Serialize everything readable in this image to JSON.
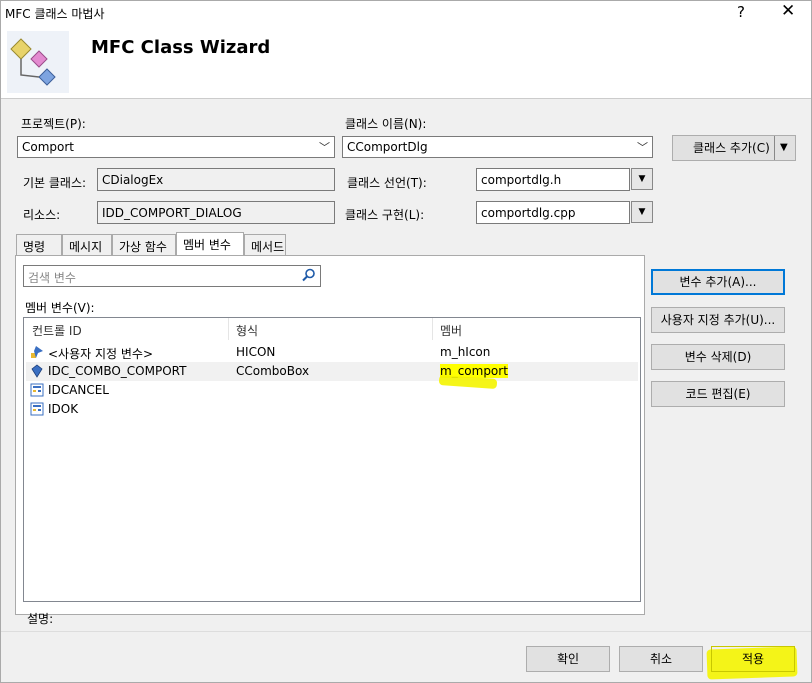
{
  "window": {
    "title": "MFC 클래스 마법사",
    "help": "?",
    "close": "✕"
  },
  "header": {
    "heading": "MFC Class Wizard"
  },
  "form": {
    "project_label": "프로젝트(P):",
    "project_value": "Comport",
    "class_name_label": "클래스 이름(N):",
    "class_name_value": "CComportDlg",
    "add_class_label": "클래스 추가(C)",
    "base_class_label": "기본 클래스:",
    "base_class_value": "CDialogEx",
    "class_decl_label": "클래스 선언(T):",
    "class_decl_value": "comportdlg.h",
    "resource_label": "리소스:",
    "resource_value": "IDD_COMPORT_DIALOG",
    "class_impl_label": "클래스 구현(L):",
    "class_impl_value": "comportdlg.cpp"
  },
  "tabs": [
    "명령",
    "메시지",
    "가상 함수",
    "멤버 변수",
    "메서드"
  ],
  "search": {
    "placeholder": "검색 변수"
  },
  "members": {
    "label": "멤버 변수(V):",
    "columns": [
      "컨트롤 ID",
      "형식",
      "멤버"
    ],
    "rows": [
      {
        "id": "<사용자 지정 변수>",
        "type": "HICON",
        "member": "m_hIcon"
      },
      {
        "id": "IDC_COMBO_COMPORT",
        "type": "CComboBox",
        "member": "m_comport"
      },
      {
        "id": "IDCANCEL",
        "type": "",
        "member": ""
      },
      {
        "id": "IDOK",
        "type": "",
        "member": ""
      }
    ]
  },
  "actions": {
    "add_variable": "변수 추가(A)...",
    "add_custom": "사용자 지정 추가(U)...",
    "delete_variable": "변수 삭제(D)",
    "edit_code": "코드 편집(E)"
  },
  "description_label": "설명:",
  "footer": {
    "ok": "확인",
    "cancel": "취소",
    "apply": "적용"
  },
  "colors": {
    "accent": "#0078d7",
    "highlight": "#ffff00"
  }
}
